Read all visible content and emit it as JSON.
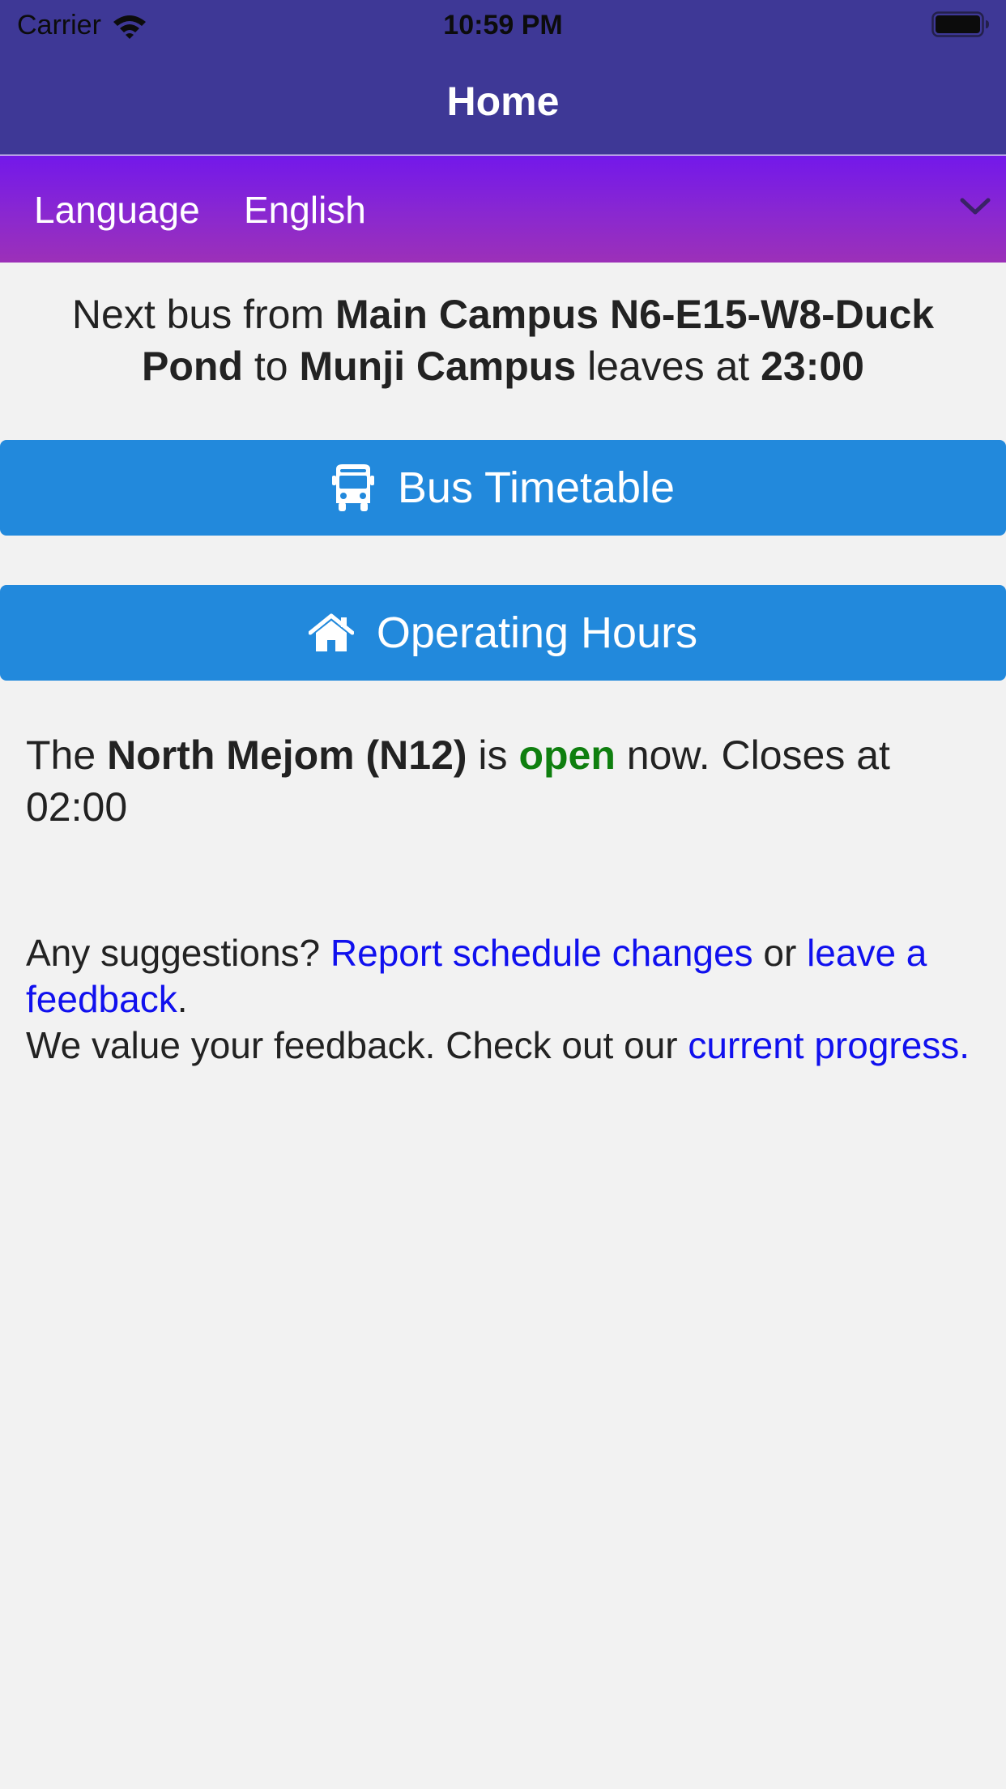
{
  "status_bar": {
    "carrier": "Carrier",
    "time": "10:59 PM"
  },
  "nav": {
    "title": "Home"
  },
  "language": {
    "label": "Language",
    "value": "English"
  },
  "next_bus": {
    "prefix": "Next bus from ",
    "from": "Main Campus N6-E15-W8-Duck Pond",
    "middle": " to ",
    "to": "Munji Campus",
    "suffix": " leaves at ",
    "time": "23:00"
  },
  "buttons": {
    "timetable": "Bus Timetable",
    "hours": "Operating Hours"
  },
  "operating": {
    "prefix": "The ",
    "place": "North Mejom (N12)",
    "is": " is ",
    "state": "open",
    "suffix": " now. Closes at 02:00"
  },
  "feedback": {
    "question": "Any suggestions? ",
    "report_link": "Report schedule changes",
    "or": " or ",
    "feedback_link": "leave a feedback",
    "period": ".",
    "value_text": "We value your feedback. Check out our ",
    "progress_link": "current progress."
  },
  "colors": {
    "nav_bar": "#3e3896",
    "language_bar_top": "#7318ea",
    "language_bar_bottom": "#9c30b8",
    "button": "#2289dc",
    "open": "#0f7f0f",
    "link": "#1010ee"
  },
  "icons": {
    "status": [
      "wifi-icon",
      "battery-icon"
    ],
    "language": "chevron-down-icon",
    "timetable": "bus-icon",
    "hours": "home-icon"
  }
}
